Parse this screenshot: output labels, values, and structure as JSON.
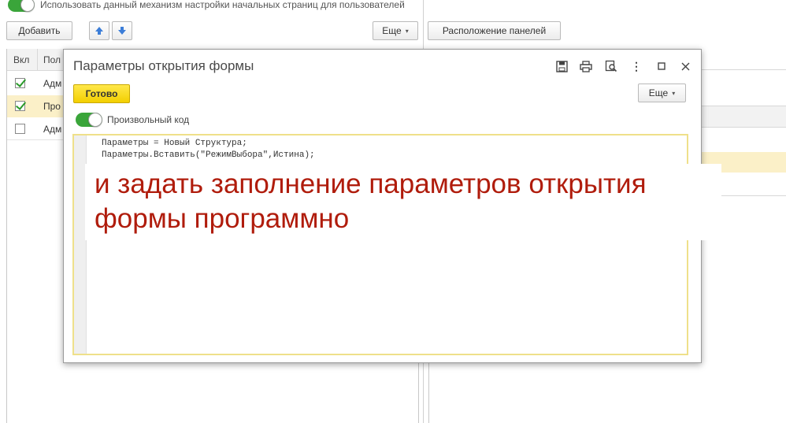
{
  "top_toggle_label": "Использовать данный механизм настройки начальных страниц для пользователей",
  "toolbar": {
    "add_label": "Добавить",
    "more_label": "Еще",
    "panels_label": "Расположение панелей"
  },
  "table": {
    "headers": [
      "Вкл",
      "Пол"
    ],
    "rows": [
      {
        "checked": true,
        "text": "Адм"
      },
      {
        "checked": true,
        "text": "Про"
      },
      {
        "checked": false,
        "text": "Адм"
      }
    ]
  },
  "dialog": {
    "title": "Параметры открытия формы",
    "done_label": "Готово",
    "more_label": "Еще",
    "toggle_label": "Произвольный код",
    "code_lines": [
      "Параметры = Новый Структура;",
      "Параметры.Вставить(\"РежимВыбора\",Истина);"
    ]
  },
  "annotation": {
    "line1": "и задать заполнение параметров открытия",
    "line2": "формы программно"
  }
}
